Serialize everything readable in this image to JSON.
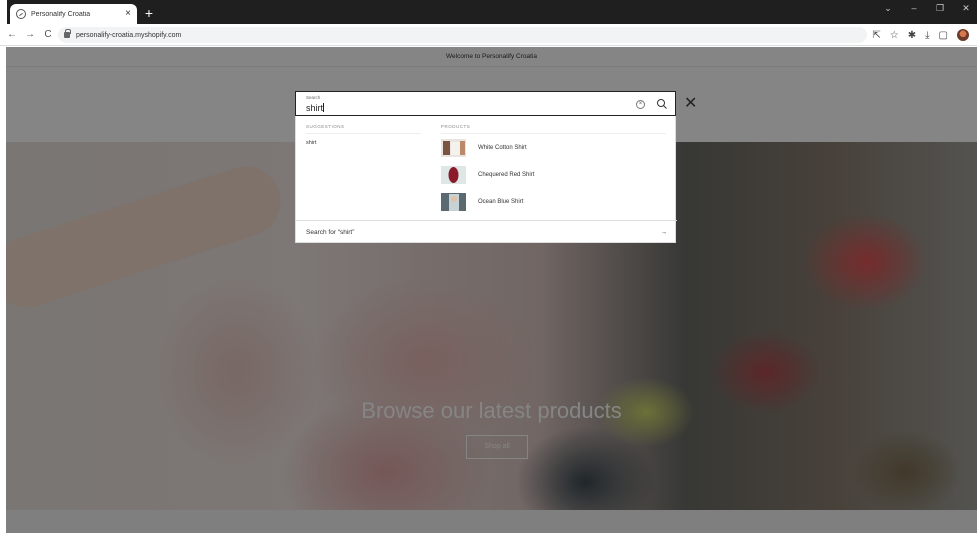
{
  "browser": {
    "tab_title": "Personalify Croatia",
    "tab_close": "×",
    "new_tab": "+",
    "url": "personalify-croatia.myshopify.com",
    "window_controls": [
      "⌄",
      "–",
      "❐",
      "✕"
    ]
  },
  "page": {
    "announcement": "Welcome to Personalify Croatia",
    "hero": {
      "title": "Browse our latest products",
      "button": "Shop all"
    }
  },
  "search": {
    "label": "Search",
    "value": "shirt",
    "close_glyph": "✕",
    "clear_glyph": "×"
  },
  "predictive": {
    "suggestions_heading": "SUGGESTIONS",
    "products_heading": "PRODUCTS",
    "suggestions": [
      "shirt"
    ],
    "products": [
      {
        "name": "White Cotton Shirt",
        "thumb_color": "#b98a6a"
      },
      {
        "name": "Chequered Red Shirt",
        "thumb_color": "#8b1a2a"
      },
      {
        "name": "Ocean Blue Shirt",
        "thumb_color": "#6b7f86"
      }
    ],
    "search_for": "Search for “shirt”",
    "arrow": "→"
  }
}
